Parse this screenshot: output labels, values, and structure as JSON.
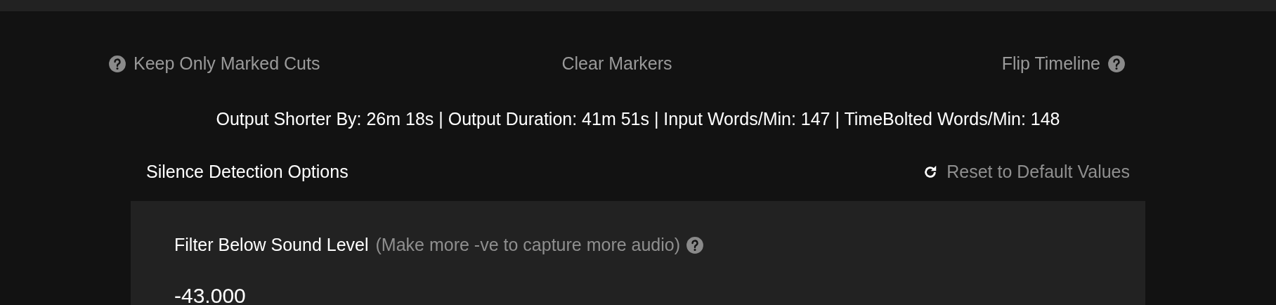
{
  "actions": [
    {
      "label": "Keep Only Marked Cuts",
      "kind": "help-left"
    },
    {
      "label": "Clear Markers",
      "kind": "plain"
    },
    {
      "label": "Flip Timeline",
      "kind": "help-right"
    }
  ],
  "summary": "Output Shorter By: 26m 18s | Output Duration: 41m 51s | Input Words/Min: 147 | TimeBolted Words/Min: 148",
  "options": {
    "title": "Silence Detection Options",
    "reset_label": "Reset to Default Values",
    "fields": [
      {
        "label": "Filter Below Sound Level",
        "hint": "(Make more -ve to capture more audio)",
        "value": "-43.000"
      }
    ]
  }
}
